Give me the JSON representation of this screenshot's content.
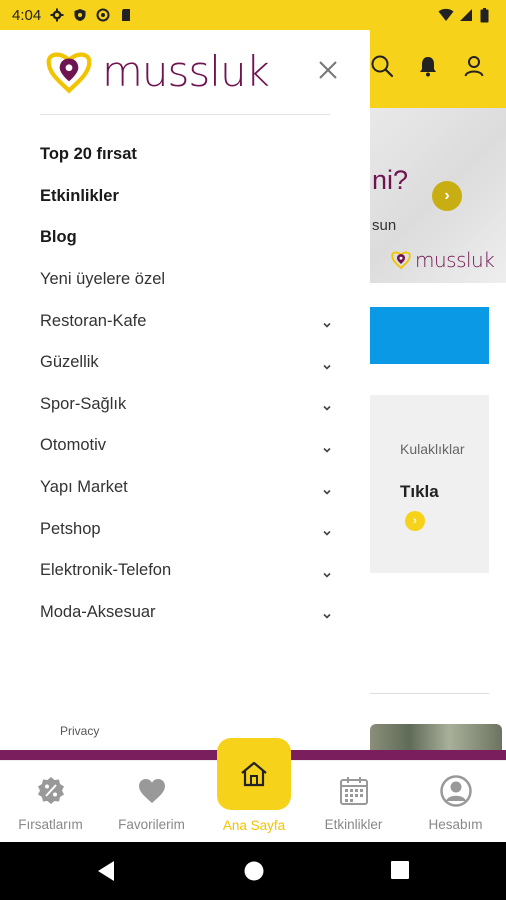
{
  "status_bar": {
    "time": "4:04",
    "left_icons": [
      "gear-icon",
      "shield-icon",
      "at-sign-icon",
      "sd-card-icon"
    ],
    "right_icons": [
      "wifi-icon",
      "signal-icon",
      "battery-icon"
    ]
  },
  "header": {
    "icons": [
      "search-icon",
      "bell-icon",
      "user-icon"
    ]
  },
  "background": {
    "banner_text": "ni?",
    "banner_sub": "sun",
    "banner_logo": "mussluk",
    "card_label": "Kulaklıklar",
    "card_cta": "Tıkla"
  },
  "drawer": {
    "logo_text": "mussluk",
    "close_icon": "close-icon",
    "menu_items": [
      {
        "label": "Top 20 fırsat",
        "bold": true,
        "expandable": false
      },
      {
        "label": "Etkinlikler",
        "bold": true,
        "expandable": false
      },
      {
        "label": "Blog",
        "bold": true,
        "expandable": false
      },
      {
        "label": "Yeni üyelere özel",
        "bold": false,
        "expandable": false
      },
      {
        "label": "Restoran-Kafe",
        "bold": false,
        "expandable": true
      },
      {
        "label": "Güzellik",
        "bold": false,
        "expandable": true
      },
      {
        "label": "Spor-Sağlık",
        "bold": false,
        "expandable": true
      },
      {
        "label": "Otomotiv",
        "bold": false,
        "expandable": true
      },
      {
        "label": "Yapı Market",
        "bold": false,
        "expandable": true
      },
      {
        "label": "Petshop",
        "bold": false,
        "expandable": true
      },
      {
        "label": "Elektronik-Telefon",
        "bold": false,
        "expandable": true
      },
      {
        "label": "Moda-Aksesuar",
        "bold": false,
        "expandable": true
      }
    ],
    "privacy": "Privacy"
  },
  "bottom_nav": {
    "items": [
      {
        "label": "Fırsatlarım",
        "icon": "discount-badge-icon"
      },
      {
        "label": "Favorilerim",
        "icon": "heart-icon"
      },
      {
        "label": "Ana Sayfa",
        "icon": "home-icon",
        "active": true
      },
      {
        "label": "Etkinlikler",
        "icon": "calendar-icon"
      },
      {
        "label": "Hesabım",
        "icon": "account-circle-icon"
      }
    ]
  },
  "system_nav": {
    "icons": [
      "back-icon",
      "home-circle-icon",
      "recents-icon"
    ]
  },
  "colors": {
    "brand_yellow": "#f7d21a",
    "brand_purple": "#6e1450",
    "active_label": "#f2c400",
    "blue_band": "#0a9ae5"
  }
}
